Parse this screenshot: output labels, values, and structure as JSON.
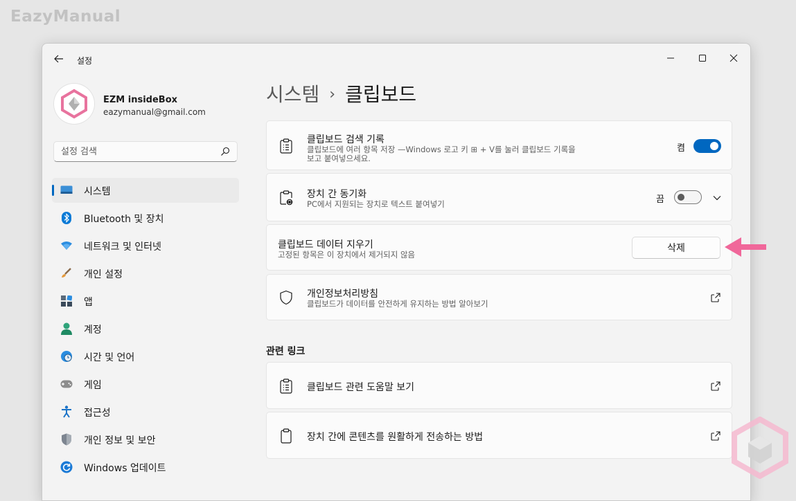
{
  "watermark": "EazyManual",
  "window": {
    "title": "설정",
    "controls": {
      "minimize": "minimize",
      "maximize": "maximize",
      "close": "close"
    }
  },
  "profile": {
    "name": "EZM insideBox",
    "email": "eazymanual@gmail.com"
  },
  "search": {
    "placeholder": "설정 검색",
    "value": ""
  },
  "sidebar": {
    "items": [
      {
        "label": "시스템",
        "icon": "monitor-icon",
        "active": true
      },
      {
        "label": "Bluetooth 및 장치",
        "icon": "bluetooth-icon"
      },
      {
        "label": "네트워크 및 인터넷",
        "icon": "wifi-icon"
      },
      {
        "label": "개인 설정",
        "icon": "brush-icon"
      },
      {
        "label": "앱",
        "icon": "apps-icon"
      },
      {
        "label": "계정",
        "icon": "account-icon"
      },
      {
        "label": "시간 및 언어",
        "icon": "globe-clock-icon"
      },
      {
        "label": "게임",
        "icon": "gamepad-icon"
      },
      {
        "label": "접근성",
        "icon": "accessibility-icon"
      },
      {
        "label": "개인 정보 및 보안",
        "icon": "shield-icon"
      },
      {
        "label": "Windows 업데이트",
        "icon": "update-icon"
      }
    ]
  },
  "breadcrumb": {
    "parent": "시스템",
    "separator": "›",
    "current": "클립보드"
  },
  "cards": {
    "history": {
      "title": "클립보드 검색 기록",
      "desc_line1": "클립보드에 여러 항목 저장 —Windows 로고 키 ⊞ + V를 눌러 클립보드 기록을",
      "desc_line2": "보고 붙여넣으세요.",
      "state_label": "켬",
      "state": "on"
    },
    "sync": {
      "title": "장치 간 동기화",
      "desc": "PC에서 지원되는 장치로 텍스트 붙여넣기",
      "state_label": "끔",
      "state": "off"
    },
    "clear": {
      "title": "클립보드 데이터 지우기",
      "desc": "고정된 항목은 이 장치에서 제거되지 않음",
      "button_label": "삭제"
    },
    "privacy": {
      "title": "개인정보처리방침",
      "desc": "클립보드가 데이터를 안전하게 유지하는 방법 알아보기"
    }
  },
  "related": {
    "title": "관련 링크",
    "links": [
      {
        "label": "클립보드 관련 도움말 보기"
      },
      {
        "label": "장치 간에 콘텐츠를 원활하게 전송하는 방법"
      }
    ]
  },
  "colors": {
    "accent": "#0067c0",
    "arrow": "#f0679a",
    "logo_pink": "#e8739e"
  }
}
